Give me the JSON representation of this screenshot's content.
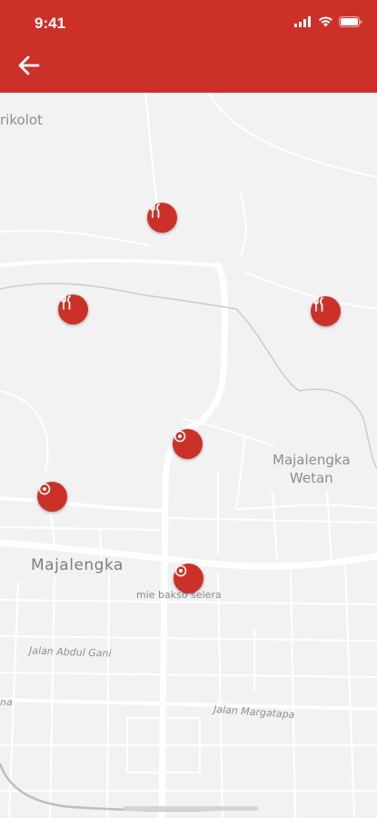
{
  "status_bar": {
    "time": "9:41"
  },
  "header": {
    "back_icon": "arrow-left-icon",
    "background": "#cc3129"
  },
  "map": {
    "labels": {
      "rikolot": "rikolot",
      "majalengka": "Majalengka",
      "majalengka_wetan": "Majalengka\nWetan",
      "poi_mie_bakso": "mie bakso selera",
      "jalan_abdul_gani": "Jalan Abdul Gani",
      "jalan_margatapa": "Jalan Margatapa",
      "na": "na"
    },
    "markers": [
      {
        "type": "restaurant",
        "icon": "fork-knife-icon"
      },
      {
        "type": "restaurant",
        "icon": "fork-knife-icon"
      },
      {
        "type": "restaurant",
        "icon": "fork-knife-icon"
      },
      {
        "type": "place",
        "icon": "place-marker-icon"
      },
      {
        "type": "place",
        "icon": "place-marker-icon"
      },
      {
        "type": "place",
        "icon": "place-marker-icon"
      }
    ],
    "marker_color": "#cc3129"
  }
}
